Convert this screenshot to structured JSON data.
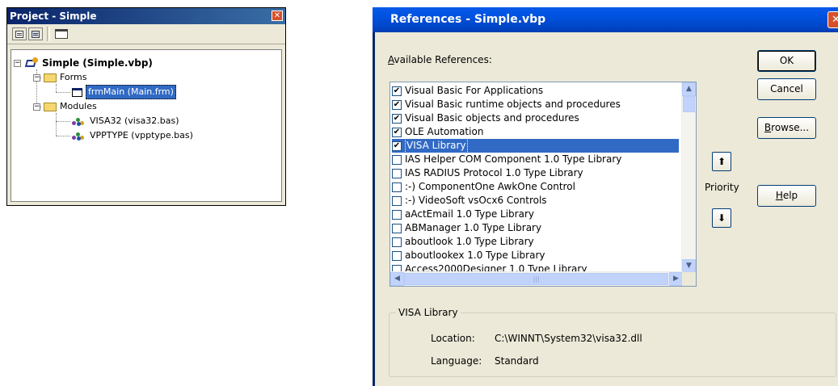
{
  "project": {
    "title": "Project - Simple",
    "close_glyph": "✕",
    "tree": {
      "root": "Simple (Simple.vbp)",
      "forms_folder": "Forms",
      "form_item": "frmMain (Main.frm)",
      "modules_folder": "Modules",
      "module_1": "VISA32 (visa32.bas)",
      "module_2": "VPPTYPE (vpptype.bas)"
    },
    "expander_glyph": "−"
  },
  "dialog": {
    "title": "References - Simple.vbp",
    "close_glyph": "✕",
    "available_label_first": "A",
    "available_label_rest": "vailable References:",
    "references": [
      {
        "label": "Visual Basic For Applications",
        "checked": true
      },
      {
        "label": "Visual Basic runtime objects and procedures",
        "checked": true
      },
      {
        "label": "Visual Basic objects and procedures",
        "checked": true
      },
      {
        "label": "OLE Automation",
        "checked": true
      },
      {
        "label": "VISA Library",
        "checked": true
      },
      {
        "label": "IAS Helper COM Component 1.0 Type Library",
        "checked": false
      },
      {
        "label": "IAS RADIUS Protocol 1.0 Type Library",
        "checked": false
      },
      {
        "label": ":-) ComponentOne AwkOne Control",
        "checked": false
      },
      {
        "label": ":-) VideoSoft vsOcx6 Controls",
        "checked": false
      },
      {
        "label": "aActEmail 1.0 Type Library",
        "checked": false
      },
      {
        "label": "ABManager 1.0 Type Library",
        "checked": false
      },
      {
        "label": "aboutlook 1.0 Type Library",
        "checked": false
      },
      {
        "label": "aboutlookex 1.0 Type Library",
        "checked": false
      },
      {
        "label": "Access2000Designer 1.0 Type Library",
        "checked": false
      }
    ],
    "check_glyph": "✔",
    "ok_label": "OK",
    "cancel_label": "Cancel",
    "browse_first": "B",
    "browse_rest": "rowse...",
    "help_first": "H",
    "help_rest": "elp",
    "priority_label": "Priority",
    "priority_up": "🠅",
    "priority_down": "🠇",
    "up_arrow": "⬆",
    "down_arrow": "⬇",
    "scroll_up": "▲",
    "scroll_down": "▼",
    "scroll_left": "◀",
    "scroll_right": "▶",
    "details_group_title": "VISA Library",
    "location_label": "Location:",
    "location_value": "C:\\WINNT\\System32\\visa32.dll",
    "language_label": "Language:",
    "language_value": "Standard"
  },
  "colors": {
    "selection": "#316ac5",
    "title_bar": "#0054e3",
    "dialog_face": "#ece9d8"
  }
}
